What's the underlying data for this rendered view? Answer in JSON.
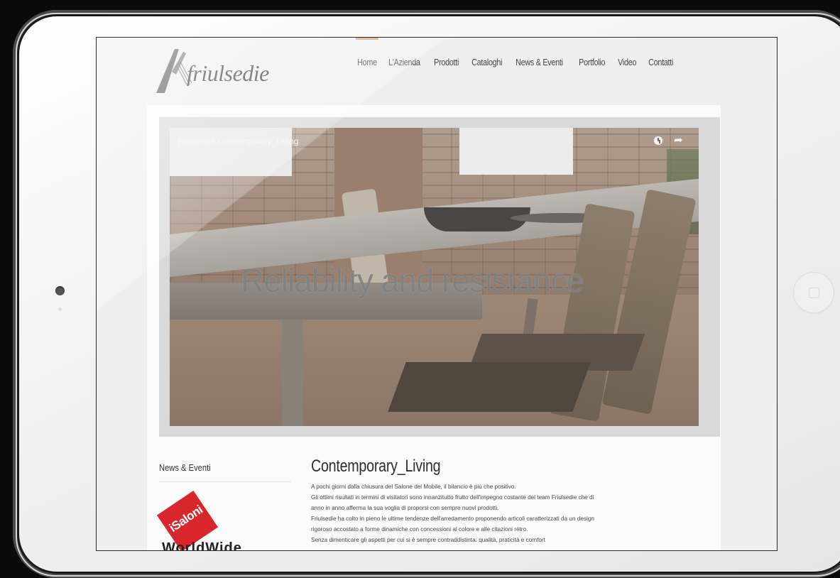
{
  "page": {
    "title": "Friulsedie Contemporary_Living"
  },
  "brand": {
    "logo_text": "friulsedie",
    "accent_color": "#c9a27a"
  },
  "nav": {
    "items": [
      {
        "label": "Home"
      },
      {
        "label": "L'Azienda"
      },
      {
        "label": "Prodotti"
      },
      {
        "label": "Cataloghi"
      },
      {
        "label": "News & Eventi"
      },
      {
        "label": "Portfolio"
      },
      {
        "label": "Video"
      },
      {
        "label": "Contatti"
      }
    ]
  },
  "video": {
    "title": "Friulsedie Contemporary_Living",
    "overlay_text": "Reliability and resistance",
    "icons": [
      "clock-icon",
      "share-icon"
    ]
  },
  "sidebar": {
    "heading": "News & Eventi",
    "logo_text": "iSaloni",
    "strong_text": "WorldWide"
  },
  "article": {
    "title": "Contemporary_Living",
    "paragraphs": [
      "A pochi giorni dalla chiusura del Salone del Mobile, il bilancio è più che positivo.",
      "Gli ottimi risultati in termini di visitatori sono innanzitutto frutto dell'impegno costante del team Friulsedie che di",
      "anno in anno afferma la sua voglia di proporsi con sempre nuovi prodotti.",
      "Friulsedie ha colto in pieno le ultime tendenze dell'arredamento proponendo articoli caratterizzati da un design",
      "rigoroso accostato a forme dinamiche con concessioni al colore e alle citazioni rétro.",
      "Senza dimenticare gli aspetti per cui si è sempre contraddistinta: qualità, praticità e comfort"
    ]
  },
  "colors": {
    "screen_bg": "#efefef",
    "card_bg": "#fbfbfb",
    "saloni_red": "#d9262d"
  }
}
